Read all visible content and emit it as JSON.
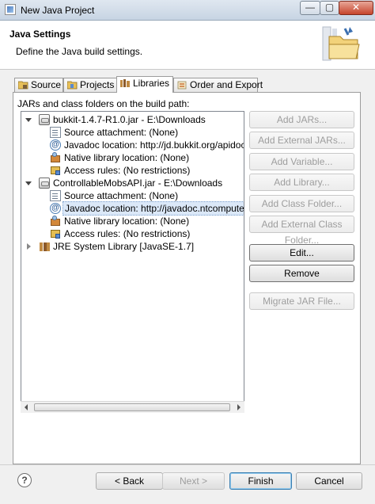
{
  "window": {
    "title": "New Java Project",
    "controls": {
      "minimize": "—",
      "maximize": "▢",
      "close": "✕"
    }
  },
  "header": {
    "title": "Java Settings",
    "description": "Define the Java build settings."
  },
  "tabs": [
    {
      "label": "Source",
      "icon": "source-folder-icon",
      "active": false
    },
    {
      "label": "Projects",
      "icon": "projects-icon",
      "active": false
    },
    {
      "label": "Libraries",
      "icon": "libraries-icon",
      "active": true
    },
    {
      "label": "Order and Export",
      "icon": "order-export-icon",
      "active": false
    }
  ],
  "libraries": {
    "label": "JARs and class folders on the build path:",
    "tree": [
      {
        "text": "bukkit-1.4.7-R1.0.jar - E:\\Downloads",
        "icon": "jar-icon",
        "level": 0,
        "expander": "open"
      },
      {
        "text": "Source attachment: (None)",
        "icon": "source-attachment-icon",
        "level": 1
      },
      {
        "text": "Javadoc location: http://jd.bukkit.org/apidocs/",
        "icon": "javadoc-icon",
        "level": 1
      },
      {
        "text": "Native library location: (None)",
        "icon": "native-library-icon",
        "level": 1
      },
      {
        "text": "Access rules: (No restrictions)",
        "icon": "access-rules-icon",
        "level": 1
      },
      {
        "text": "ControllableMobsAPI.jar - E:\\Downloads",
        "icon": "jar-icon",
        "level": 0,
        "expander": "open"
      },
      {
        "text": "Source attachment: (None)",
        "icon": "source-attachment-icon",
        "level": 1
      },
      {
        "text": "Javadoc location: http://javadoc.ntcomputer.de/",
        "icon": "javadoc-icon",
        "level": 1,
        "selected": true
      },
      {
        "text": "Native library location: (None)",
        "icon": "native-library-icon",
        "level": 1
      },
      {
        "text": "Access rules: (No restrictions)",
        "icon": "access-rules-icon",
        "level": 1
      },
      {
        "text": "JRE System Library [JavaSE-1.7]",
        "icon": "library-icon",
        "level": 0,
        "expander": "closed"
      }
    ],
    "buttons": [
      {
        "label": "Add JARs...",
        "enabled": false
      },
      {
        "label": "Add External JARs...",
        "enabled": false
      },
      {
        "label": "Add Variable...",
        "enabled": false
      },
      {
        "label": "Add Library...",
        "enabled": false
      },
      {
        "label": "Add Class Folder...",
        "enabled": false
      },
      {
        "label": "Add External Class Folder...",
        "enabled": false
      },
      {
        "label": "Edit...",
        "enabled": true
      },
      {
        "label": "Remove",
        "enabled": true
      },
      {
        "label": "Migrate JAR File...",
        "enabled": false
      }
    ]
  },
  "footer": {
    "help": "?",
    "back": "< Back",
    "next": "Next >",
    "finish": "Finish",
    "cancel": "Cancel"
  }
}
